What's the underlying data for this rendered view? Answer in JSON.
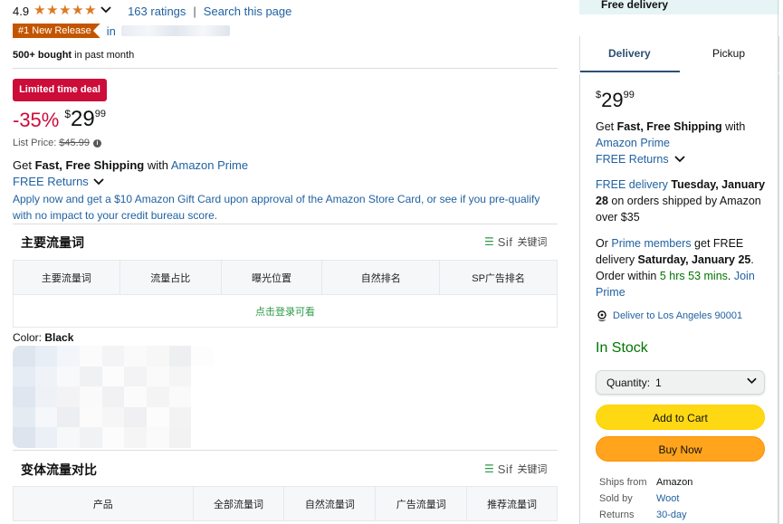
{
  "product": {
    "rating_value": "4.9",
    "stars_count": 5,
    "ratings_link": "163 ratings",
    "search_link": "Search this page",
    "new_release_badge": "#1 New Release",
    "in_prefix": "in",
    "bought_bold": "500+ bought",
    "bought_rest": " in past month",
    "deal_badge": "Limited time deal",
    "discount": "-35%",
    "price": {
      "symbol": "$",
      "whole": "29",
      "fraction": "99"
    },
    "list_price_label": "List Price:",
    "list_price_value": "$45.99",
    "shipping": {
      "get": "Get ",
      "fast": "Fast, Free Shipping",
      "with": " with ",
      "prime": "Amazon Prime"
    },
    "free_returns": "FREE Returns",
    "apply_text": "Apply now and get a $10 Amazon Gift Card upon approval of the Amazon Store Card, or see if you pre-qualify with no impact to your credit bureau score.",
    "color_label": "Color: ",
    "color_value": "Black"
  },
  "keywords_section": {
    "title": "主要流量词",
    "sif_word": "Sif",
    "sif_label": "关键词",
    "headers": [
      "主要流量词",
      "流量占比",
      "曝光位置",
      "自然排名",
      "SP广告排名"
    ],
    "login_prompt": "点击登录可看"
  },
  "variants_section": {
    "title": "变体流量对比",
    "sif_word": "Sif",
    "sif_label": "关键词",
    "headers": [
      "产品",
      "全部流量词",
      "自然流量词",
      "广告流量词",
      "推荐流量词"
    ]
  },
  "buybox": {
    "banner": "Free delivery",
    "tabs": [
      "Delivery",
      "Pickup"
    ],
    "price": {
      "symbol": "$",
      "whole": "29",
      "fraction": "99"
    },
    "ship": {
      "get": "Get ",
      "fast": "Fast, Free Shipping",
      "with": " with ",
      "prime": "Amazon Prime"
    },
    "free_returns": "FREE Returns",
    "delivery": {
      "free_delivery": "FREE delivery",
      "date": " Tuesday, January 28",
      "rest": " on orders shipped by Amazon over $35"
    },
    "prime_offer": {
      "or": "Or ",
      "members": "Prime members",
      "get": " get FREE delivery ",
      "date": "Saturday, January 25",
      "order_within": ". Order within ",
      "countdown": "5 hrs 53 mins",
      "dot": ". ",
      "join": "Join Prime"
    },
    "location": "Deliver to Los Angeles 90001",
    "stock": "In Stock",
    "quantity_label": "Quantity:",
    "quantity_value": "1",
    "add_to_cart": "Add to Cart",
    "buy_now": "Buy Now",
    "ships_from_label": "Ships from",
    "ships_from_value": "Amazon",
    "sold_by_label": "Sold by",
    "sold_by_value": "Woot",
    "returns_label": "Returns",
    "returns_value": "30-day"
  },
  "colors": {
    "star": "#de7921",
    "link": "#2162a1",
    "deal_red": "#cc0c39",
    "stock_green": "#007600",
    "cart_yellow": "#ffd814",
    "buy_orange": "#ffa41c",
    "sif_green": "#2e9a46"
  }
}
